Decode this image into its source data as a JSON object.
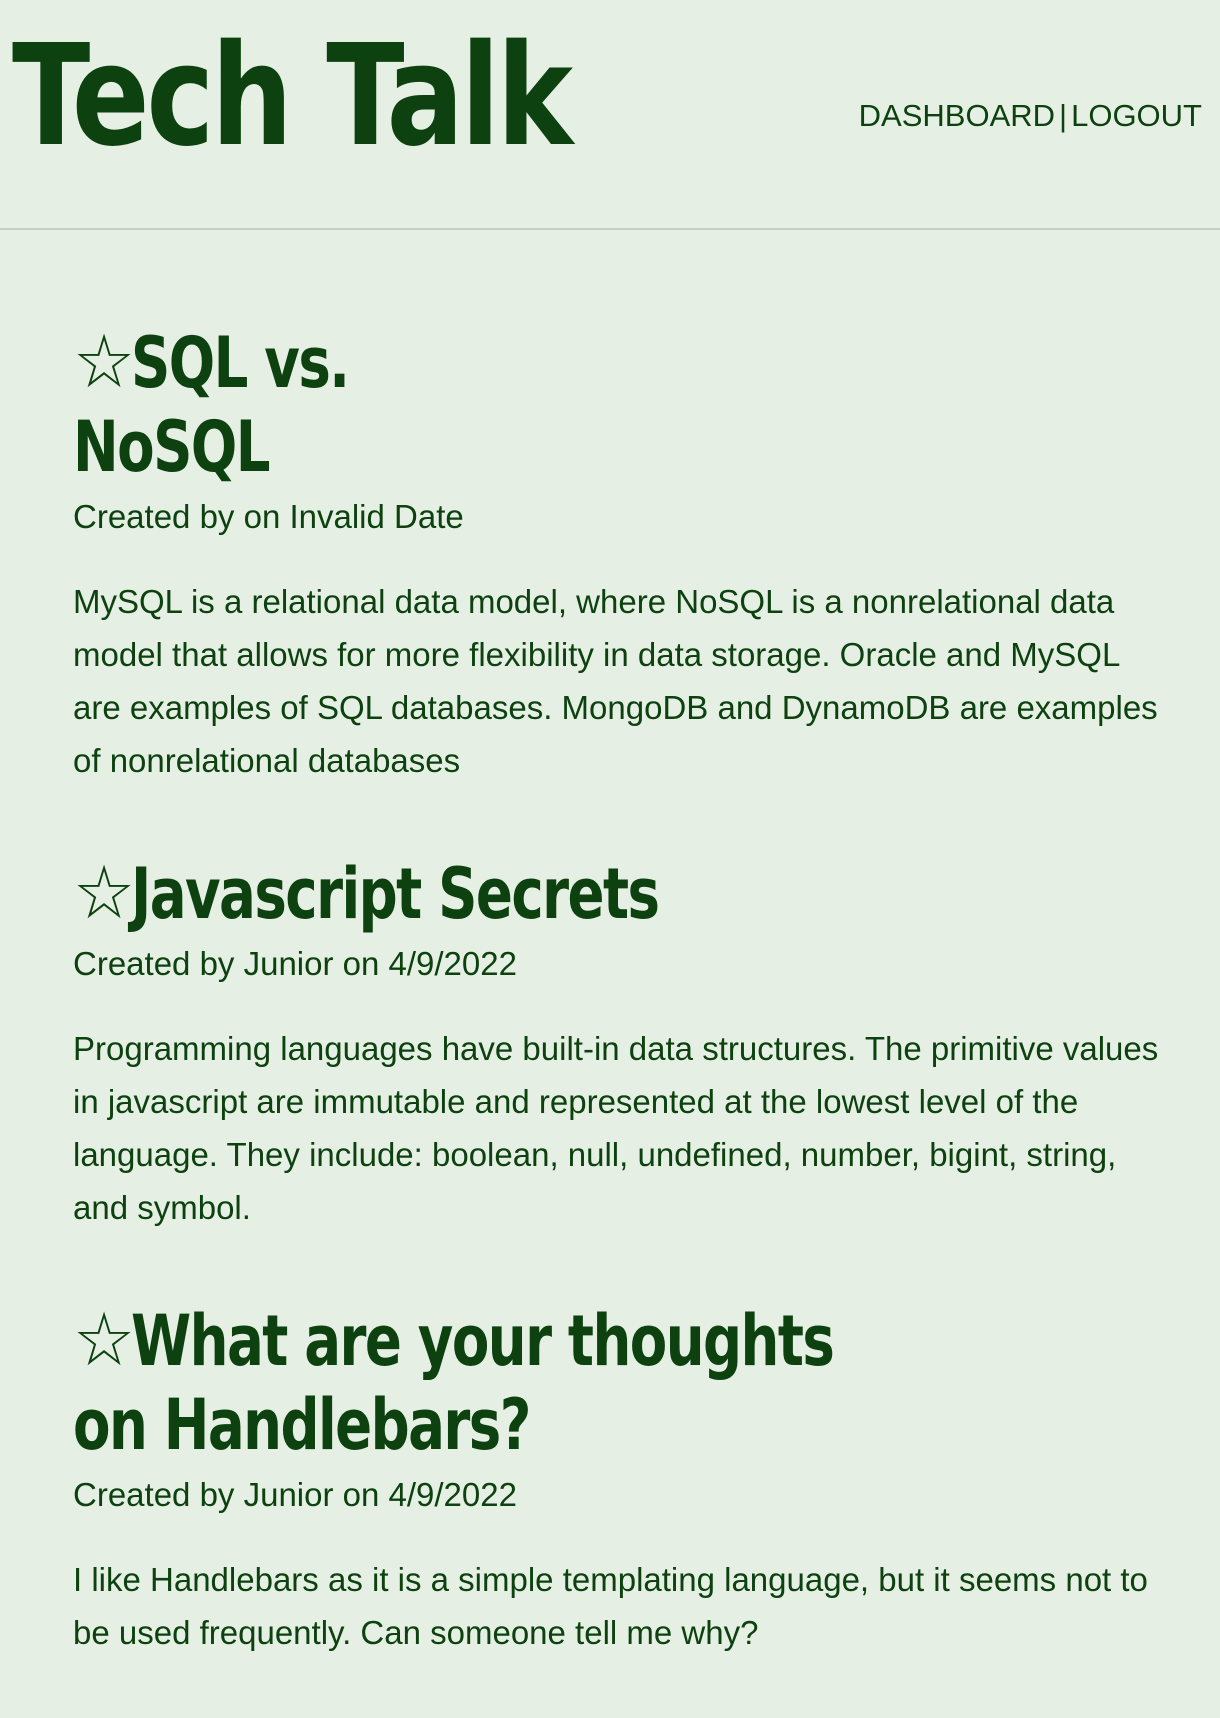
{
  "header": {
    "site_title": "Tech Talk",
    "nav": {
      "dashboard_label": "DASHBOARD",
      "separator": "|",
      "logout_label": "LOGOUT"
    }
  },
  "posts": [
    {
      "star": "☆",
      "title": "SQL vs. NoSQL",
      "meta": "Created by on Invalid Date",
      "body": "MySQL is a relational data model, where NoSQL is a nonrelational data model that allows for more flexibility in data storage. Oracle and MySQL are examples of SQL databases. MongoDB and DynamoDB are examples of nonrelational databases"
    },
    {
      "star": "☆",
      "title": "Javascript Secrets",
      "meta": "Created by Junior on 4/9/2022",
      "body": "Programming languages have built-in data structures. The primitive values in javascript are immutable and represented at the lowest level of the language. They include: boolean, null, undefined, number, bigint, string, and symbol."
    },
    {
      "star": "☆",
      "title": "What are your thoughts on Handlebars?",
      "meta": "Created by Junior on 4/9/2022",
      "body": "I like Handlebars as it is a simple templating language, but it seems not to be used frequently. Can someone tell me why?"
    }
  ]
}
